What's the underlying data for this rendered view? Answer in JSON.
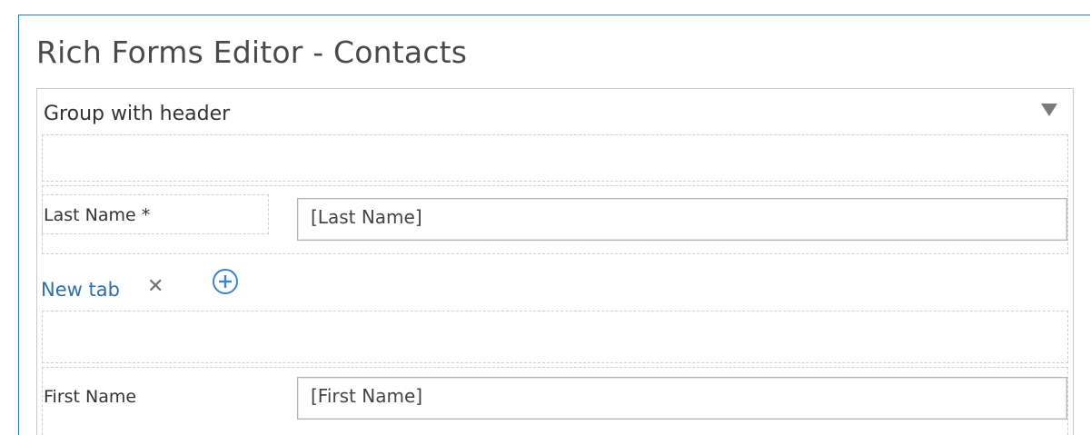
{
  "form": {
    "title": "Rich Forms Editor - Contacts"
  },
  "group": {
    "header": "Group with header",
    "collapse_icon": "triangle-down-icon"
  },
  "fields": {
    "last_name": {
      "label": "Last Name *",
      "value": "[Last Name]"
    },
    "first_name": {
      "label": "First Name",
      "value": "[First Name]"
    }
  },
  "tabs": {
    "items": [
      {
        "label": "New tab",
        "close_icon": "close-icon"
      }
    ],
    "add_icon": "plus-circle-icon"
  },
  "colors": {
    "frame_accent": "#2f7cbf",
    "tab_link": "#2f6fa7"
  }
}
